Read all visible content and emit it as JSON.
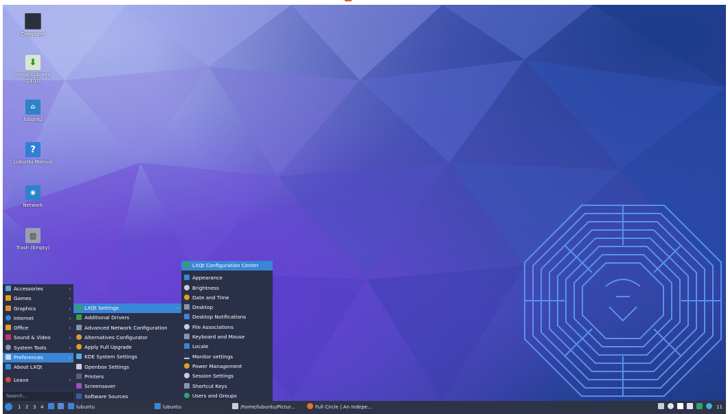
{
  "desktop_icons": [
    {
      "label": "Computer",
      "icon": "computer-icon"
    },
    {
      "label": "Install Lubuntu 23.10",
      "icon": "install-icon"
    },
    {
      "label": "lubuntu",
      "icon": "home-folder-icon"
    },
    {
      "label": "Lubuntu Manual",
      "icon": "help-icon"
    },
    {
      "label": "Network",
      "icon": "network-icon"
    },
    {
      "label": "Trash (Empty)",
      "icon": "trash-icon"
    }
  ],
  "main_menu": {
    "items": [
      "Accessories",
      "Games",
      "Graphics",
      "Internet",
      "Office",
      "Sound & Video",
      "System Tools",
      "Preferences",
      "About LXQt",
      "Leave"
    ],
    "search_placeholder": "Search..."
  },
  "preferences_menu": {
    "items": [
      "LXQt Settings",
      "Additional Drivers",
      "Advanced Network Configuration",
      "Alternatives Configurator",
      "Apply Full Upgrade",
      "KDE System Settings",
      "Openbox Settings",
      "Printers",
      "Screensaver",
      "Software Sources"
    ]
  },
  "lxqt_settings_menu": {
    "items": [
      "LXQt Configuration Center",
      "Appearance",
      "Brightness",
      "Date and Time",
      "Desktop",
      "Desktop Notifications",
      "File Associations",
      "Keyboard and Mouse",
      "Locale",
      "Monitor settings",
      "Power Management",
      "Session Settings",
      "Shortcut Keys",
      "Users and Groups"
    ]
  },
  "taskbar": {
    "workspaces": [
      "1",
      "2",
      "3",
      "4"
    ],
    "tasks": [
      "lubuntu",
      "lubuntu",
      "/home/lubuntu/Pictur...",
      "Full Circle | An Indepe..."
    ],
    "clock": "11"
  },
  "colors": {
    "menu_bg": "#2a3048",
    "highlight": "#3a86d6",
    "taskbar_bg": "#2e3346"
  }
}
